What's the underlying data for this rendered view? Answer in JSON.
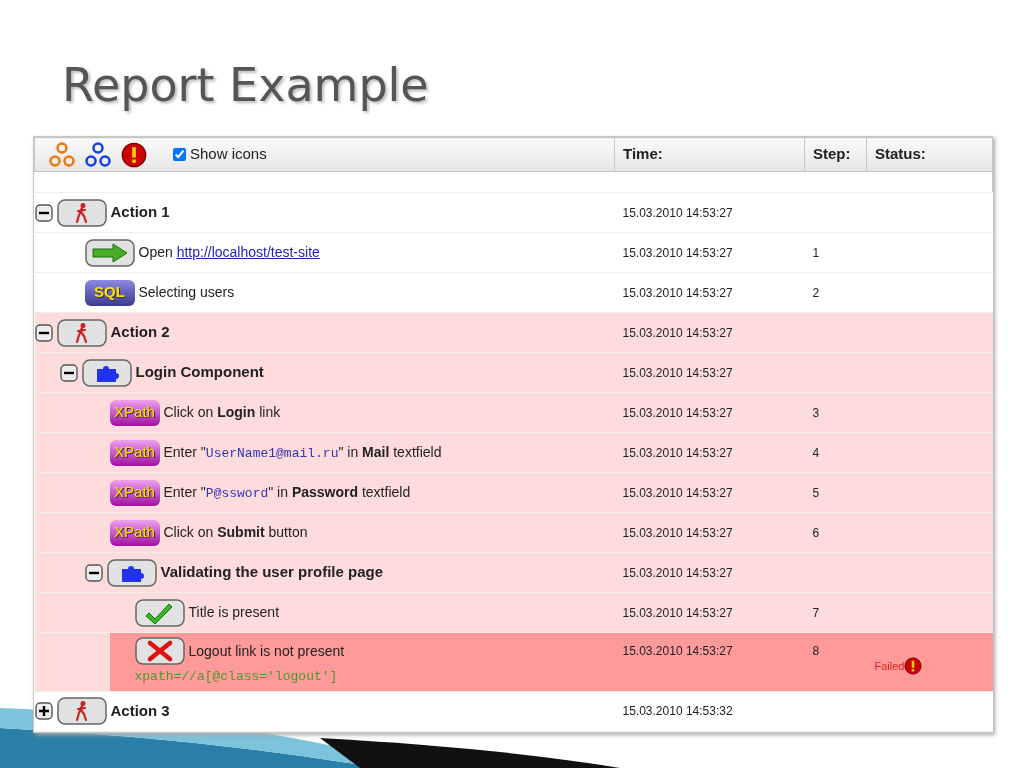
{
  "slide": {
    "title": "Report Example"
  },
  "toolbar": {
    "buttons": [
      {
        "kind": "expand_all"
      },
      {
        "kind": "collapse_all"
      },
      {
        "kind": "errors"
      }
    ],
    "show_icons": {
      "label": "Show icons",
      "checked": true
    }
  },
  "columns": [
    "Time:",
    "Step:",
    "Status:"
  ],
  "tree": [
    {
      "kind": "group",
      "icon": {
        "kind": "walker"
      },
      "label": "Action 1",
      "time": "15.03.2010 14:53:27",
      "expanded": true,
      "failed": false,
      "contains_failure": false,
      "children": [
        {
          "kind": "step",
          "icon": {
            "kind": "arrow"
          },
          "parts": [
            {
              "kind": "plain",
              "text": "Open "
            },
            {
              "kind": "link",
              "text": "http://localhost/test-site"
            }
          ],
          "time": "15.03.2010 14:53:27",
          "step": "1",
          "failed": false,
          "contains_failure": false
        },
        {
          "kind": "step",
          "icon": {
            "kind": "sql",
            "label": "SQL"
          },
          "parts": [
            {
              "kind": "plain",
              "text": "Selecting users"
            }
          ],
          "time": "15.03.2010 14:53:27",
          "step": "2",
          "failed": false,
          "contains_failure": false
        }
      ]
    },
    {
      "kind": "group",
      "icon": {
        "kind": "walker"
      },
      "label": "Action 2",
      "time": "15.03.2010 14:53:27",
      "expanded": true,
      "failed": false,
      "contains_failure": true,
      "children": [
        {
          "kind": "group",
          "icon": {
            "kind": "puzzle"
          },
          "label": "Login Component",
          "time": "15.03.2010 14:53:27",
          "expanded": true,
          "failed": false,
          "contains_failure": true,
          "children": [
            {
              "kind": "step",
              "icon": {
                "kind": "xpath",
                "label": "XPath"
              },
              "parts": [
                {
                  "kind": "plain",
                  "text": "Click on "
                },
                {
                  "kind": "bold",
                  "text": "Login"
                },
                {
                  "kind": "plain",
                  "text": " link"
                }
              ],
              "time": "15.03.2010 14:53:27",
              "step": "3",
              "failed": false,
              "contains_failure": true
            },
            {
              "kind": "step",
              "icon": {
                "kind": "xpath",
                "label": "XPath"
              },
              "parts": [
                {
                  "kind": "plain",
                  "text": "Enter \""
                },
                {
                  "kind": "code",
                  "text": "UserName1@mail.ru"
                },
                {
                  "kind": "plain",
                  "text": "\" in "
                },
                {
                  "kind": "bold",
                  "text": "Mail"
                },
                {
                  "kind": "plain",
                  "text": " textfield"
                }
              ],
              "time": "15.03.2010 14:53:27",
              "step": "4",
              "failed": false,
              "contains_failure": true
            },
            {
              "kind": "step",
              "icon": {
                "kind": "xpath",
                "label": "XPath"
              },
              "parts": [
                {
                  "kind": "plain",
                  "text": "Enter \""
                },
                {
                  "kind": "code",
                  "text": "P@ssword"
                },
                {
                  "kind": "plain",
                  "text": "\" in "
                },
                {
                  "kind": "bold",
                  "text": "Password"
                },
                {
                  "kind": "plain",
                  "text": " textfield"
                }
              ],
              "time": "15.03.2010 14:53:27",
              "step": "5",
              "failed": false,
              "contains_failure": true
            },
            {
              "kind": "step",
              "icon": {
                "kind": "xpath",
                "label": "XPath"
              },
              "parts": [
                {
                  "kind": "plain",
                  "text": "Click on "
                },
                {
                  "kind": "bold",
                  "text": "Submit"
                },
                {
                  "kind": "plain",
                  "text": " button"
                }
              ],
              "time": "15.03.2010 14:53:27",
              "step": "6",
              "failed": false,
              "contains_failure": true
            },
            {
              "kind": "group",
              "icon": {
                "kind": "puzzle"
              },
              "label": "Validating the user profile page",
              "time": "15.03.2010 14:53:27",
              "expanded": true,
              "failed": false,
              "contains_failure": true,
              "children": [
                {
                  "kind": "step",
                  "icon": {
                    "kind": "check"
                  },
                  "parts": [
                    {
                      "kind": "plain",
                      "text": "Title is present"
                    }
                  ],
                  "time": "15.03.2010 14:53:27",
                  "step": "7",
                  "failed": false,
                  "contains_failure": true
                },
                {
                  "kind": "step",
                  "icon": {
                    "kind": "cross"
                  },
                  "parts": [
                    {
                      "kind": "plain",
                      "text": "Logout link is not present"
                    }
                  ],
                  "detail": "xpath=//a[@class='logout']",
                  "time": "15.03.2010 14:53:27",
                  "step": "8",
                  "failed": true,
                  "status": "Failed"
                }
              ]
            }
          ]
        }
      ]
    },
    {
      "kind": "group",
      "icon": {
        "kind": "walker"
      },
      "label": "Action 3",
      "time": "15.03.2010 14:53:32",
      "expanded": false,
      "failed": false,
      "contains_failure": false
    }
  ]
}
